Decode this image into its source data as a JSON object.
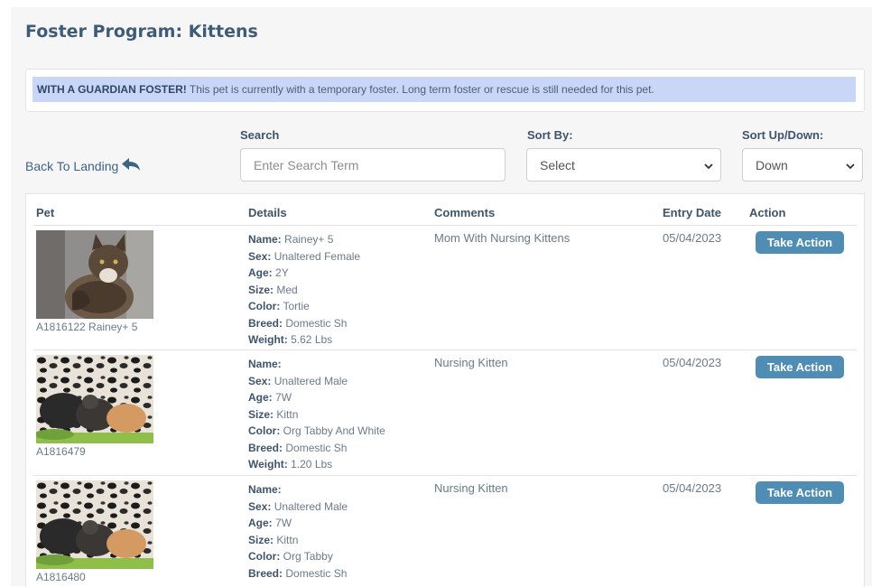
{
  "page_title": "Foster Program: Kittens",
  "banner": {
    "strong": "WITH A GUARDIAN FOSTER!",
    "text": " This pet is currently with a temporary foster. Long term foster or rescue is still needed for this pet."
  },
  "back_link": "Back To Landing",
  "search": {
    "label": "Search",
    "placeholder": "Enter Search Term",
    "value": ""
  },
  "sort_by": {
    "label": "Sort By:",
    "selected": "Select"
  },
  "sort_dir": {
    "label": "Sort Up/Down:",
    "selected": "Down"
  },
  "table": {
    "headers": {
      "pet": "Pet",
      "details": "Details",
      "comments": "Comments",
      "entry_date": "Entry Date",
      "action": "Action"
    },
    "field_labels": {
      "name": "Name:",
      "sex": "Sex:",
      "age": "Age:",
      "size": "Size:",
      "color": "Color:",
      "breed": "Breed:",
      "weight": "Weight:"
    },
    "rows": [
      {
        "pet_id": "A1816122  Rainey+ 5",
        "name": "Rainey+ 5",
        "sex": "Unaltered Female",
        "age": "2Y",
        "size": "Med",
        "color": "Tortie",
        "breed": "Domestic Sh",
        "weight": "5.62 Lbs",
        "comments": "Mom With Nursing Kittens",
        "entry_date": "05/04/2023",
        "action": "Take Action"
      },
      {
        "pet_id": "A1816479",
        "name": "",
        "sex": "Unaltered Male",
        "age": "7W",
        "size": "Kittn",
        "color": "Org Tabby And White",
        "breed": "Domestic Sh",
        "weight": "1.20 Lbs",
        "comments": "Nursing Kitten",
        "entry_date": "05/04/2023",
        "action": "Take Action"
      },
      {
        "pet_id": "A1816480",
        "name": "",
        "sex": "Unaltered Male",
        "age": "7W",
        "size": "Kittn",
        "color": "Org Tabby",
        "breed": "Domestic Sh",
        "comments": "Nursing Kitten",
        "entry_date": "05/04/2023",
        "action": "Take Action"
      }
    ]
  },
  "colors": {
    "title": "#3e5b78",
    "banner_bg": "#c9d6f8",
    "button_bg": "#4f8db4",
    "link": "#3c6584"
  }
}
